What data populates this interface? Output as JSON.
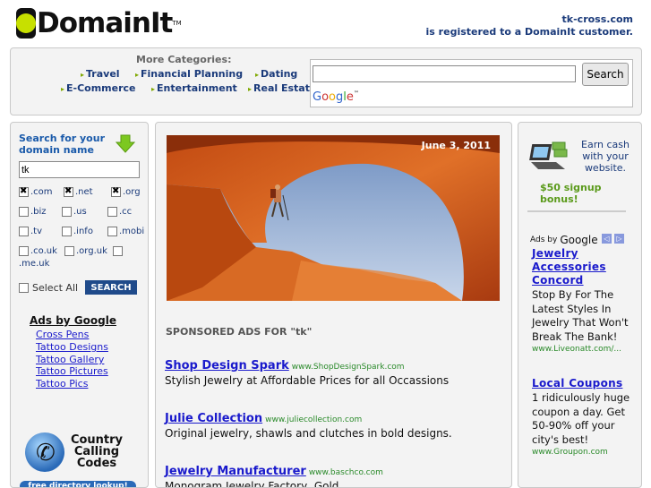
{
  "header": {
    "logo_text": "DomainIt",
    "logo_tm": "TM",
    "domain": "tk-cross.com",
    "registered_text": "is registered to a DomainIt customer."
  },
  "categories": {
    "title": "More Categories:",
    "items": [
      "Travel",
      "Financial Planning",
      "Dating",
      "E-Commerce",
      "Entertainment",
      "Real Estate"
    ]
  },
  "search": {
    "input_value": "",
    "button_label": "Search",
    "provider": "Google"
  },
  "domain_search": {
    "title_line1": "Search for your",
    "title_line2": "domain name",
    "input_value": "tk",
    "tlds": [
      {
        "label": ".com",
        "checked": true
      },
      {
        "label": ".net",
        "checked": true
      },
      {
        "label": ".org",
        "checked": true
      },
      {
        "label": ".biz",
        "checked": false
      },
      {
        "label": ".us",
        "checked": false
      },
      {
        "label": ".cc",
        "checked": false
      },
      {
        "label": ".tv",
        "checked": false
      },
      {
        "label": ".info",
        "checked": false
      },
      {
        "label": ".mobi",
        "checked": false
      },
      {
        "label": ".co.uk",
        "checked": false
      },
      {
        "label": ".org.uk",
        "checked": false
      },
      {
        "label": ".me.uk",
        "checked": false
      }
    ],
    "select_all_label": "Select All",
    "search_button": "SEARCH"
  },
  "ads_by_google_left": {
    "title": "Ads by Google",
    "links": [
      "Cross Pens",
      "Tattoo Designs",
      "Tattoo Gallery",
      "Tattoo Pictures",
      "Tattoo Pics"
    ]
  },
  "country_codes": {
    "line1": "Country",
    "line2": "Calling",
    "line3": "Codes",
    "directory_label": "free directory lookup!"
  },
  "featured": {
    "date": "June 3, 2011"
  },
  "sponsored": {
    "heading": "SPONSORED ADS FOR \"tk\"",
    "ads": [
      {
        "title": "Shop Design Spark",
        "url": "www.ShopDesignSpark.com",
        "desc": "Stylish Jewelry at Affordable Prices for all Occassions"
      },
      {
        "title": "Julie Collection",
        "url": "www.juliecollection.com",
        "desc": "Original jewelry, shawls and clutches in bold designs."
      },
      {
        "title": "Jewelry Manufacturer",
        "url": "www.baschco.com",
        "desc": "Monogram Jewelry Factory, Gold,"
      }
    ]
  },
  "earn": {
    "line1": "Earn cash",
    "line2": "with your",
    "line3": "website.",
    "bonus": "$50 signup bonus!"
  },
  "ads_by_google_right": {
    "label_prefix": "Ads by",
    "label_brand": "Google",
    "prev": "◁",
    "next": "▷",
    "ads": [
      {
        "title": "Jewelry Accessories Concord",
        "desc": "Stop By For The Latest Styles In Jewelry That Won't Break The Bank!",
        "url": "www.Liveonatt.com/..."
      },
      {
        "title": "Local Coupons",
        "desc": "1 ridiculously huge coupon a day. Get 50-90% off your city's best!",
        "url": "www.Groupon.com"
      }
    ]
  }
}
